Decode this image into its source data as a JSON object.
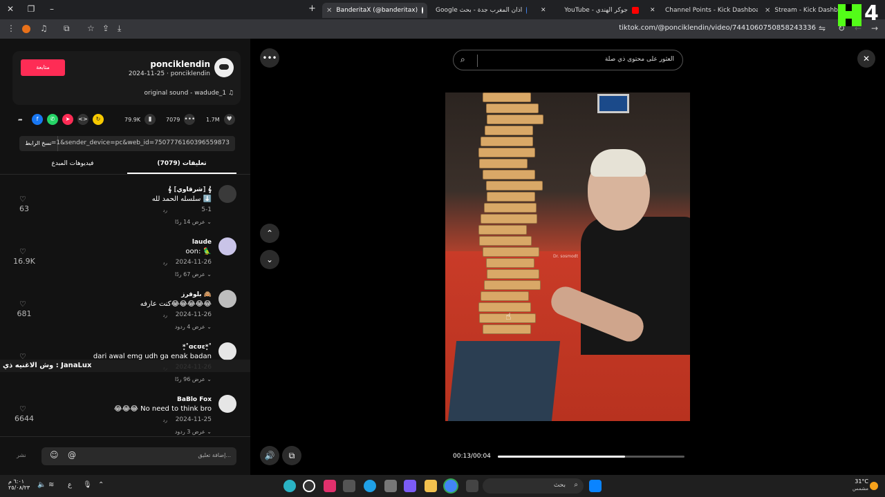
{
  "browser": {
    "tabs": [
      {
        "title": "BanderitaX (@banderitax)",
        "active": true
      },
      {
        "title": "اذان المغرب جدة - بحث Google",
        "active": false
      },
      {
        "title": "جوكر الهندي - YouTube",
        "active": false
      },
      {
        "title": "Channel Points - Kick Dashboar",
        "active": false
      },
      {
        "title": "Stream - Kick Dashboard",
        "active": false
      }
    ],
    "new_tab_label": "+",
    "url": "tiktok.com/@ponciklendin/video/7441060750858243336"
  },
  "post": {
    "follow_label": "متابعة",
    "author_name": "ponciklendin",
    "author_meta": "2024-11-25 · ponciklendin",
    "music": "original sound - wadude_1",
    "likes": "1.7M",
    "comments_count": "7079",
    "saves": "79.9K",
    "copy_link_label": "نسخ الرابط",
    "link_text": "=1&sender_device=pc&web_id=7507776160396559873",
    "tab_comments": "(7079) تعليقات",
    "tab_creator_videos": "فيديوهات المبدع"
  },
  "comments": [
    {
      "name": "𝄞 ⟦شرقاوي⟧ 𝄞",
      "text": "سلسله الحمد لله ⬇️",
      "date": "5-1",
      "reply": "رد",
      "more": "عرض 14 ردًا",
      "likes": "63"
    },
    {
      "name": "laude",
      "text": "oon: 🦜",
      "date": "2024-11-26",
      "reply": "رد",
      "more": "عرض 67 ردًا",
      "likes": "16.9K"
    },
    {
      "name": "بلوقرز 🙈",
      "text": "كنت عارفه😂😂😂😂😂",
      "date": "2024-11-26",
      "reply": "رد",
      "more": "عرض 4 ردود",
      "likes": "681"
    },
    {
      "name": "*̥˚ɑcʊε*̥˚",
      "text": "dari awal emg udh ga enak badan",
      "date": "2024-11-26",
      "reply": "رد",
      "more": "عرض 96 ردًا",
      "likes": ""
    },
    {
      "name": "BaBlo Fox",
      "text": "😂😂😂 No need to think bro",
      "date": "2024-11-25",
      "reply": "رد",
      "more": "عرض 3 ردود",
      "likes": "6644"
    }
  ],
  "overlay": {
    "text": "وش الاغنيه ذي : JanaLux"
  },
  "compose": {
    "placeholder": "إضافة تعليق...",
    "post_label": "نشر"
  },
  "video": {
    "search_placeholder": "العثور على محتوى ذي صلة",
    "time": "00:13/00:04",
    "progress_fraction": 0.68,
    "watermark": "Dr. sosmodt"
  },
  "taskbar": {
    "search_label": "بحث",
    "temperature": "31°C",
    "weather": "مشمس",
    "time": "٦:٠١ م",
    "date": "٢٥/٠٨/٢٣",
    "lang": "ع"
  },
  "overlay_brand": {
    "number": "4"
  },
  "colors": {
    "accent": "#fe2c55",
    "kick": "#53fc18"
  }
}
